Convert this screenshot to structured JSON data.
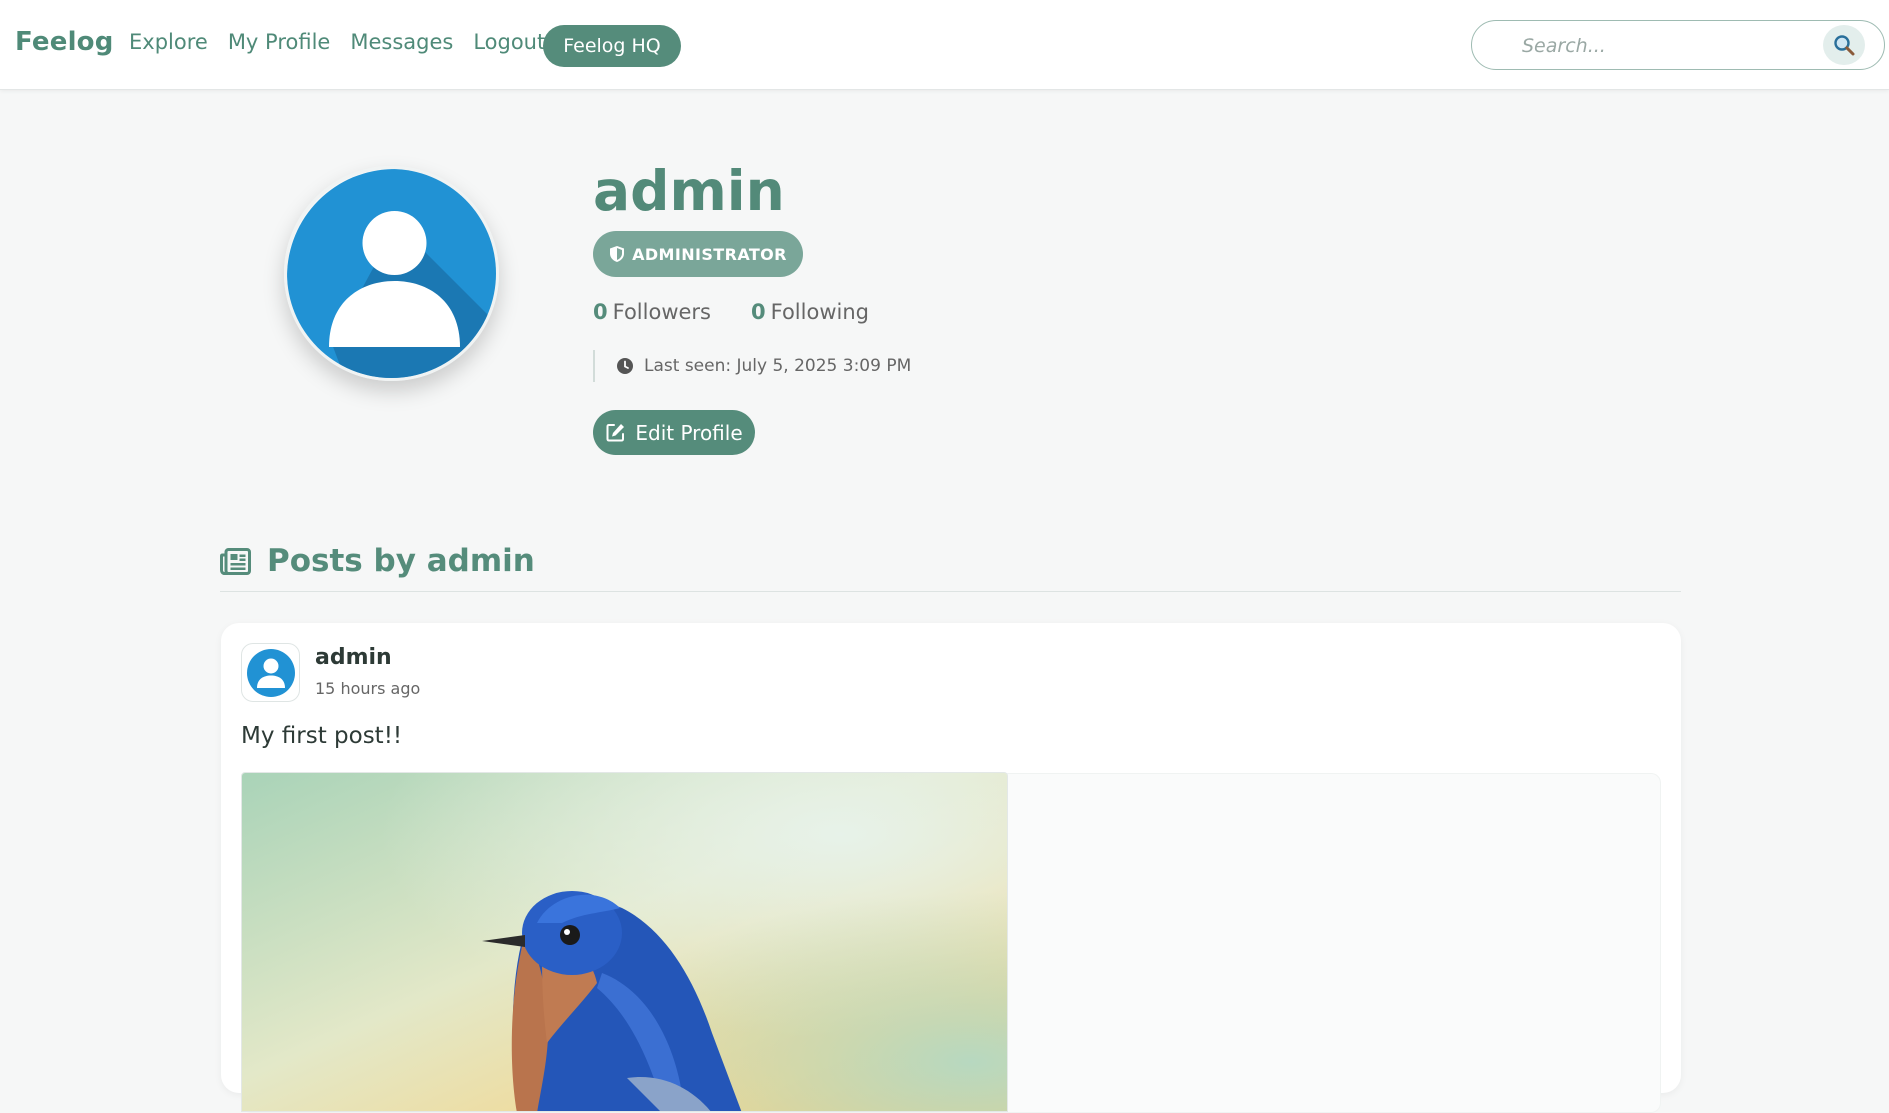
{
  "brand": "Feelog",
  "nav": {
    "links": [
      "Explore",
      "My Profile",
      "Messages",
      "Logout"
    ],
    "hq_button": "Feelog HQ"
  },
  "search": {
    "placeholder": "Search...",
    "value": "",
    "icon": "search-icon"
  },
  "profile": {
    "username": "admin",
    "role_badge": "ADMINISTRATOR",
    "followers_count": "0",
    "followers_label": "Followers",
    "following_count": "0",
    "following_label": "Following",
    "last_seen": "Last seen: July 5, 2025 3:09 PM",
    "edit_button": "Edit Profile"
  },
  "posts_section": {
    "heading": "Posts by admin",
    "posts": [
      {
        "author": "admin",
        "time": "15 hours ago",
        "text": "My first post!!",
        "image": "bluebird-photo"
      }
    ]
  },
  "colors": {
    "accent": "#558c7b",
    "badge": "#7aa699",
    "avatar_blue": "#1e8fd0",
    "background": "#f6f7f7"
  }
}
